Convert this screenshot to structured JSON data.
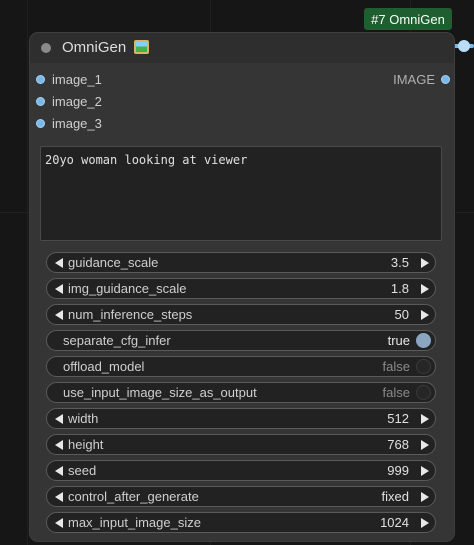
{
  "canvas": {
    "background": "#161616"
  },
  "node_badge": {
    "text": "#7 OmniGen",
    "color": "#1f5e2e"
  },
  "node": {
    "title": "OmniGen",
    "title_icon": "framed-picture-icon",
    "inputs": [
      {
        "label": "image_1"
      },
      {
        "label": "image_2"
      },
      {
        "label": "image_3"
      }
    ],
    "output": {
      "label": "IMAGE"
    },
    "slot_color": "#7ab8e8",
    "prompt": "20yo woman looking at viewer",
    "widgets": {
      "guidance_scale": {
        "label": "guidance_scale",
        "value": "3.5"
      },
      "img_guidance_scale": {
        "label": "img_guidance_scale",
        "value": "1.8"
      },
      "num_inference_steps": {
        "label": "num_inference_steps",
        "value": "50"
      },
      "separate_cfg_infer": {
        "label": "separate_cfg_infer",
        "value": "true"
      },
      "offload_model": {
        "label": "offload_model",
        "value": "false"
      },
      "use_input_image_size_as_output": {
        "label": "use_input_image_size_as_output",
        "value": "false"
      },
      "width": {
        "label": "width",
        "value": "512"
      },
      "height": {
        "label": "height",
        "value": "768"
      },
      "seed": {
        "label": "seed",
        "value": "999"
      },
      "control_after_generate": {
        "label": "control_after_generate",
        "value": "fixed"
      },
      "max_input_image_size": {
        "label": "max_input_image_size",
        "value": "1024"
      }
    }
  }
}
